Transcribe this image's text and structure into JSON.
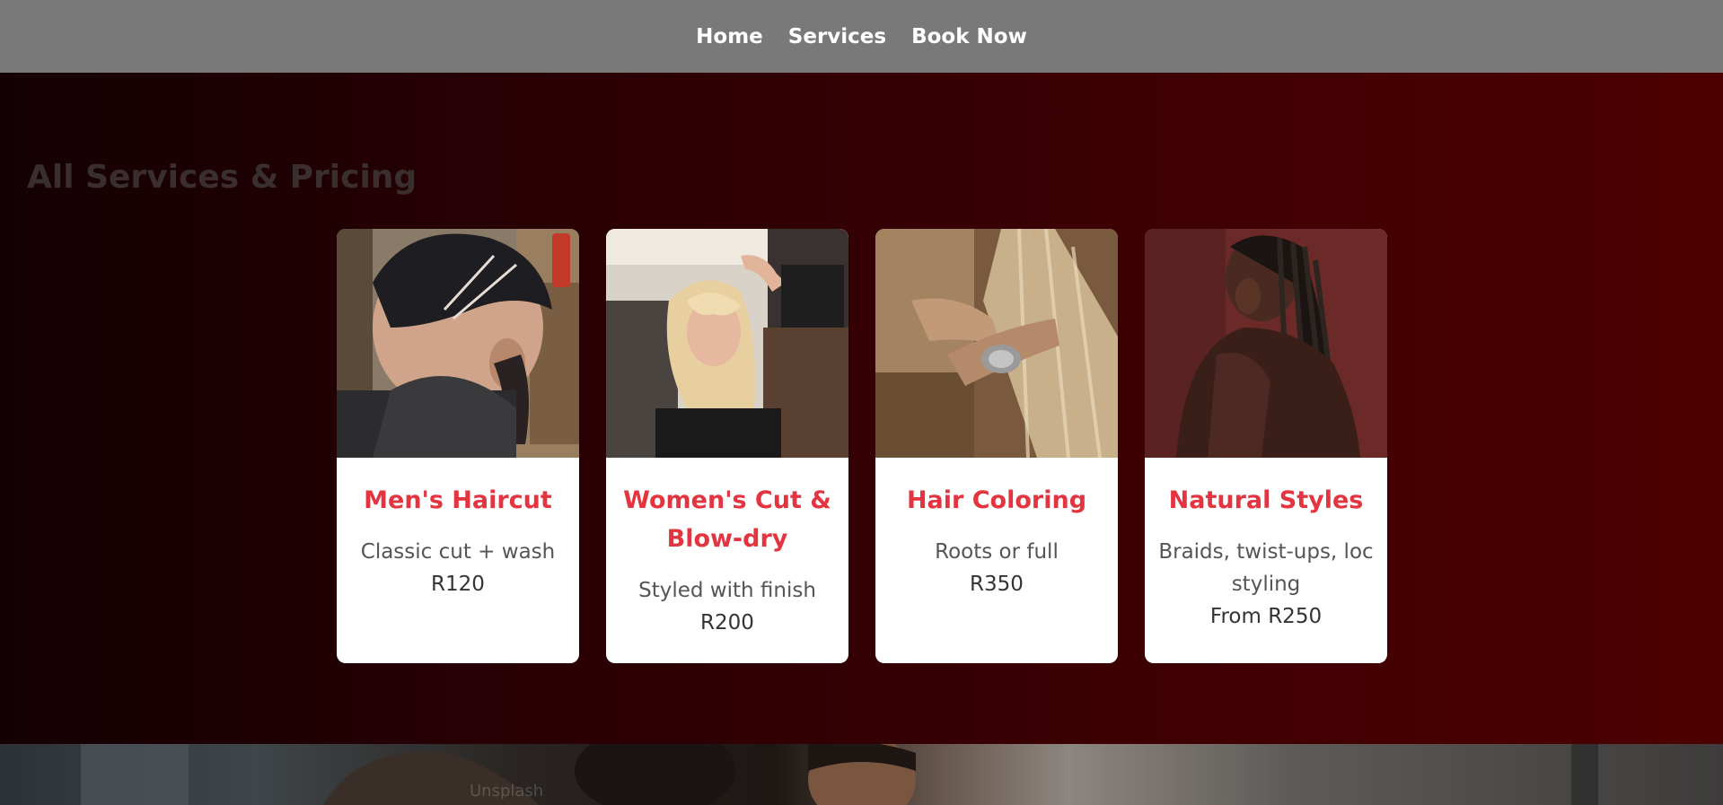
{
  "nav": {
    "items": [
      {
        "label": "Home"
      },
      {
        "label": "Services"
      },
      {
        "label": "Book Now"
      }
    ]
  },
  "services": {
    "title": "All Services & Pricing",
    "cards": [
      {
        "title": "Men's Haircut",
        "description": "Classic cut + wash",
        "price": "R120",
        "image": "mens-haircut-photo"
      },
      {
        "title": "Women's Cut & Blow-dry",
        "description": "Styled with finish",
        "price": "R200",
        "image": "womens-blowdry-photo"
      },
      {
        "title": "Hair Coloring",
        "description": "Roots or full",
        "price": "R350",
        "image": "hair-coloring-photo"
      },
      {
        "title": "Natural Styles",
        "description": "Braids, twist-ups, loc styling",
        "price": "From R250",
        "image": "natural-styles-photo"
      }
    ]
  },
  "hero": {
    "watermark": "Unsplash",
    "image": "salon-hero-photo"
  }
}
